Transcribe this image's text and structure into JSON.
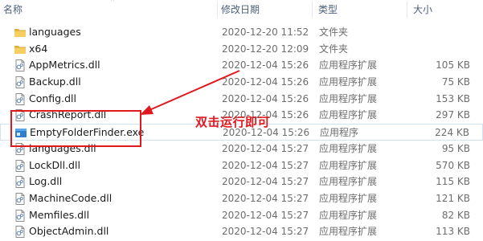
{
  "columns": {
    "name": "名称",
    "date": "修改日期",
    "type": "类型",
    "size": "大小"
  },
  "files": [
    {
      "name": "languages",
      "date": "2020-12-20 11:52",
      "type": "文件夹",
      "size": "",
      "icon": "folder-icon"
    },
    {
      "name": "x64",
      "date": "2020-12-20 12:09",
      "type": "文件夹",
      "size": "",
      "icon": "folder-icon"
    },
    {
      "name": "AppMetrics.dll",
      "date": "2020-12-04 15:26",
      "type": "应用程序扩展",
      "size": "105 KB",
      "icon": "dll-file-icon"
    },
    {
      "name": "Backup.dll",
      "date": "2020-12-04 15:26",
      "type": "应用程序扩展",
      "size": "75 KB",
      "icon": "dll-file-icon"
    },
    {
      "name": "Config.dll",
      "date": "2020-12-04 15:26",
      "type": "应用程序扩展",
      "size": "153 KB",
      "icon": "dll-file-icon"
    },
    {
      "name": "CrashReport.dll",
      "date": "2020-12-04 15:26",
      "type": "应用程序扩展",
      "size": "297 KB",
      "icon": "dll-file-icon"
    },
    {
      "name": "EmptyFolderFinder.exe",
      "date": "2020-12-04 15:26",
      "type": "应用程序",
      "size": "224 KB",
      "icon": "exe-app-icon"
    },
    {
      "name": "languages.dll",
      "date": "2020-12-04 15:27",
      "type": "应用程序扩展",
      "size": "95 KB",
      "icon": "dll-file-icon"
    },
    {
      "name": "LockDll.dll",
      "date": "2020-12-04 15:27",
      "type": "应用程序扩展",
      "size": "570 KB",
      "icon": "dll-file-icon"
    },
    {
      "name": "Log.dll",
      "date": "2020-12-04 15:27",
      "type": "应用程序扩展",
      "size": "115 KB",
      "icon": "dll-file-icon"
    },
    {
      "name": "MachineCode.dll",
      "date": "2020-12-04 15:27",
      "type": "应用程序扩展",
      "size": "121 KB",
      "icon": "dll-file-icon"
    },
    {
      "name": "Memfiles.dll",
      "date": "2020-12-04 15:27",
      "type": "应用程序扩展",
      "size": "82 KB",
      "icon": "dll-file-icon"
    },
    {
      "name": "ObjectAdmin.dll",
      "date": "2020-12-04 15:27",
      "type": "应用程序扩展",
      "size": "113 KB",
      "icon": "dll-file-icon"
    }
  ],
  "annotation": {
    "text": "双击运行即可",
    "color": "#e0191e"
  }
}
